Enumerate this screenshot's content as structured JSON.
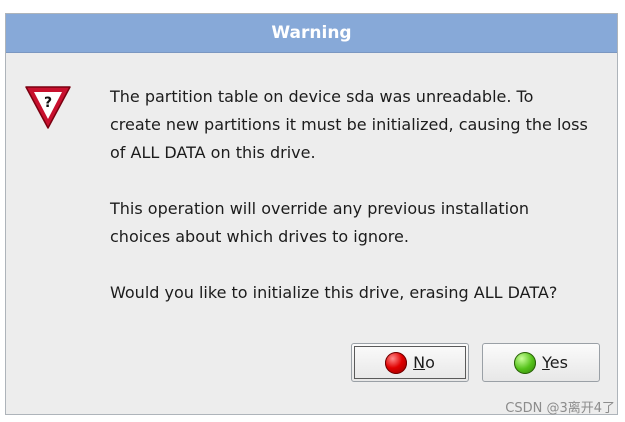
{
  "dialog": {
    "title": "Warning",
    "icon": "warning-question-icon",
    "messages": [
      "The partition table on device sda was unreadable. To\ncreate new partitions it must be initialized, causing the loss\nof ALL DATA on this drive.",
      "This operation will override any previous installation\nchoices about which drives to ignore.",
      "Would you like to initialize this drive, erasing ALL DATA?"
    ]
  },
  "buttons": {
    "no": {
      "mnemonic": "N",
      "rest": "o"
    },
    "yes": {
      "mnemonic": "Y",
      "rest": "es"
    }
  },
  "watermark": "CSDN @3离开4了",
  "colors": {
    "titlebar": "#87a9d8",
    "dialog_bg": "#ededed",
    "icon_red": "#c8102e",
    "no_orb": "#e00000",
    "yes_orb": "#55c21a"
  }
}
